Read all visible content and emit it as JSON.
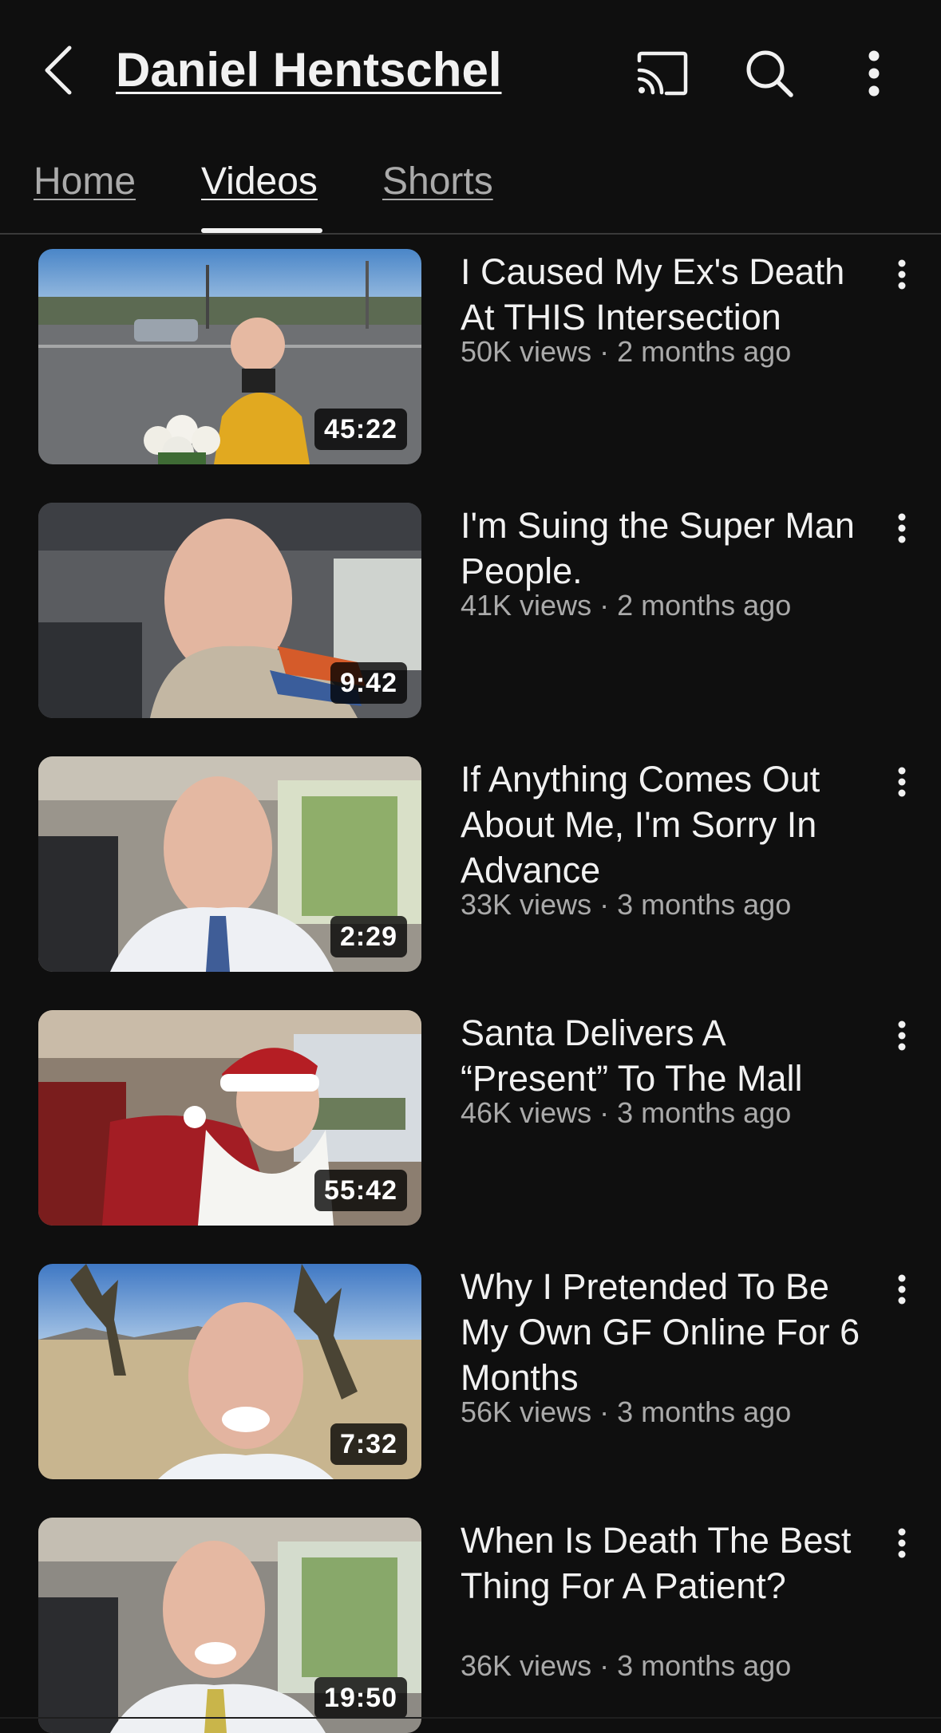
{
  "header": {
    "channel_name": "Daniel Hentschel",
    "icons": [
      "back-arrow-icon",
      "cast-icon",
      "search-icon",
      "more-vert-icon"
    ]
  },
  "tabs": [
    {
      "label": "Home",
      "active": false
    },
    {
      "label": "Videos",
      "active": true
    },
    {
      "label": "Shorts",
      "active": false
    }
  ],
  "videos": [
    {
      "title": "I Caused My Ex's Death At THIS Intersection",
      "duration": "45:22",
      "views": "50K views",
      "age": "2 months ago",
      "meta": "50K views · 2 months ago"
    },
    {
      "title": "I'm Suing the Super Man People.",
      "duration": "9:42",
      "views": "41K views",
      "age": "2 months ago",
      "meta": "41K views · 2 months ago"
    },
    {
      "title": "If Anything Comes Out About Me, I'm Sorry In Advance",
      "duration": "2:29",
      "views": "33K views",
      "age": "3 months ago",
      "meta": "33K views · 3 months ago"
    },
    {
      "title": "Santa Delivers A “Present” To The Mall",
      "duration": "55:42",
      "views": "46K views",
      "age": "3 months ago",
      "meta": "46K views · 3 months ago"
    },
    {
      "title": "Why I Pretended To Be My Own GF Online For 6 Months",
      "duration": "7:32",
      "views": "56K views",
      "age": "3 months ago",
      "meta": "56K views · 3 months ago"
    },
    {
      "title": "When Is Death The Best Thing For A Patient?",
      "duration": "19:50",
      "views": "36K views",
      "age": "3 months ago",
      "meta": "36K views · 3 months ago"
    }
  ],
  "colors": {
    "background": "#0f0f0f",
    "text_primary": "#f1f1f1",
    "text_secondary": "#aaaaaa",
    "duration_badge": "#000000"
  }
}
